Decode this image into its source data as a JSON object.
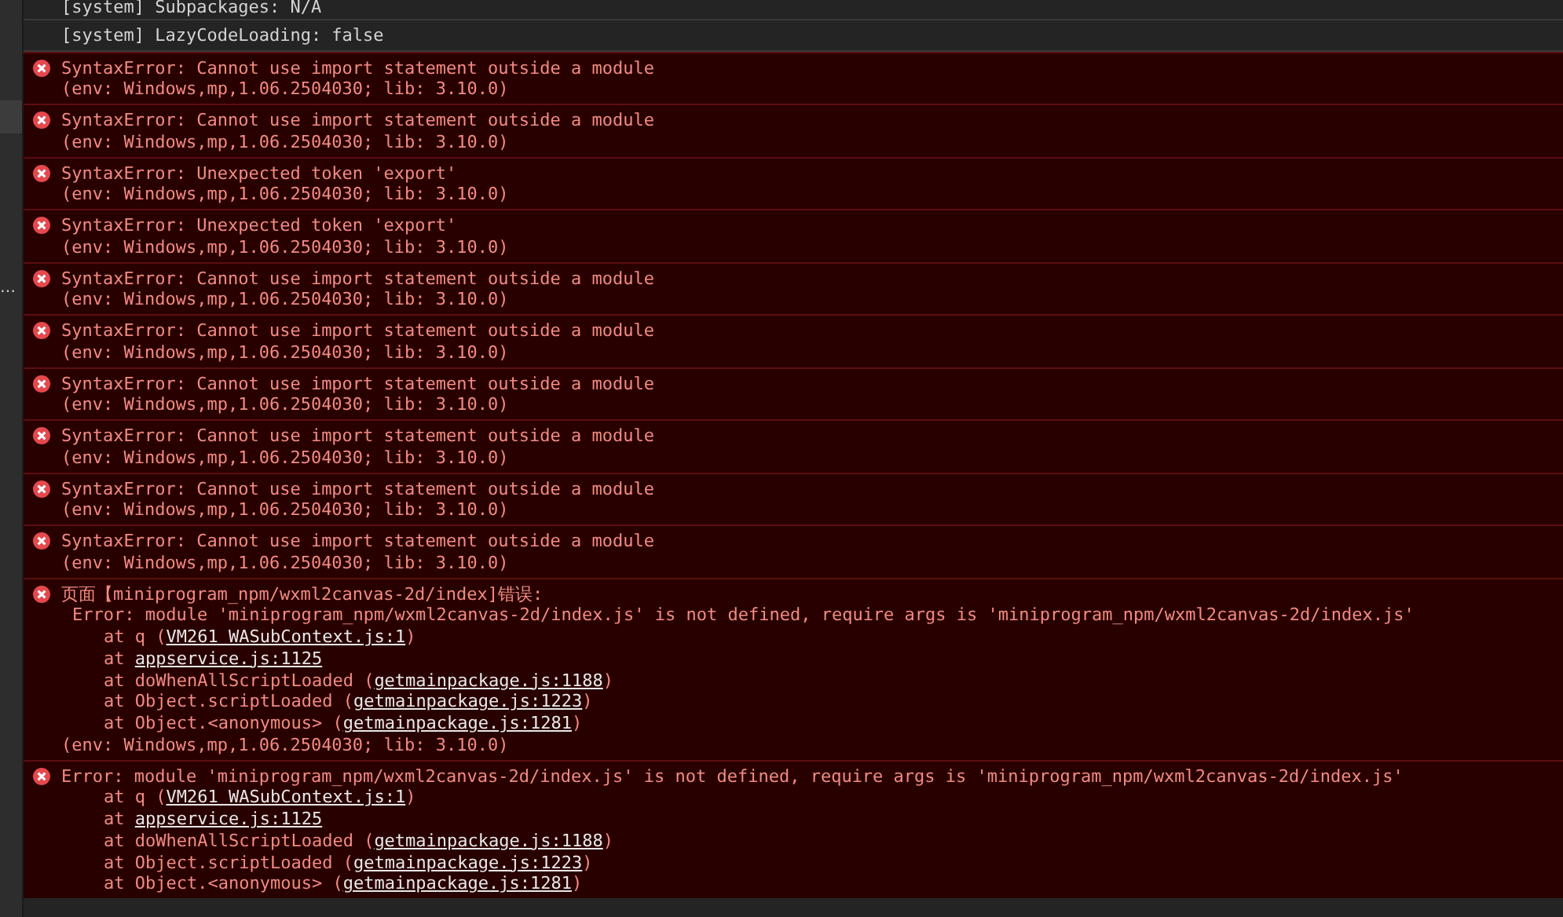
{
  "sidebar": {
    "cut_label": "…"
  },
  "messages": [
    {
      "kind": "system",
      "lines": [
        {
          "kind": "text",
          "text": "[system] Subpackages: N/A"
        }
      ]
    },
    {
      "kind": "system",
      "lines": [
        {
          "kind": "text",
          "text": "[system] LazyCodeLoading: false"
        }
      ]
    },
    {
      "kind": "error",
      "lines": [
        {
          "kind": "text",
          "text": "SyntaxError: Cannot use import statement outside a module"
        },
        {
          "kind": "text",
          "text": "(env: Windows,mp,1.06.2504030; lib: 3.10.0)"
        }
      ]
    },
    {
      "kind": "error",
      "lines": [
        {
          "kind": "text",
          "text": "SyntaxError: Cannot use import statement outside a module"
        },
        {
          "kind": "text",
          "text": "(env: Windows,mp,1.06.2504030; lib: 3.10.0)"
        }
      ]
    },
    {
      "kind": "error",
      "lines": [
        {
          "kind": "text",
          "text": "SyntaxError: Unexpected token 'export'"
        },
        {
          "kind": "text",
          "text": "(env: Windows,mp,1.06.2504030; lib: 3.10.0)"
        }
      ]
    },
    {
      "kind": "error",
      "lines": [
        {
          "kind": "text",
          "text": "SyntaxError: Unexpected token 'export'"
        },
        {
          "kind": "text",
          "text": "(env: Windows,mp,1.06.2504030; lib: 3.10.0)"
        }
      ]
    },
    {
      "kind": "error",
      "lines": [
        {
          "kind": "text",
          "text": "SyntaxError: Cannot use import statement outside a module"
        },
        {
          "kind": "text",
          "text": "(env: Windows,mp,1.06.2504030; lib: 3.10.0)"
        }
      ]
    },
    {
      "kind": "error",
      "lines": [
        {
          "kind": "text",
          "text": "SyntaxError: Cannot use import statement outside a module"
        },
        {
          "kind": "text",
          "text": "(env: Windows,mp,1.06.2504030; lib: 3.10.0)"
        }
      ]
    },
    {
      "kind": "error",
      "lines": [
        {
          "kind": "text",
          "text": "SyntaxError: Cannot use import statement outside a module"
        },
        {
          "kind": "text",
          "text": "(env: Windows,mp,1.06.2504030; lib: 3.10.0)"
        }
      ]
    },
    {
      "kind": "error",
      "lines": [
        {
          "kind": "text",
          "text": "SyntaxError: Cannot use import statement outside a module"
        },
        {
          "kind": "text",
          "text": "(env: Windows,mp,1.06.2504030; lib: 3.10.0)"
        }
      ]
    },
    {
      "kind": "error",
      "lines": [
        {
          "kind": "text",
          "text": "SyntaxError: Cannot use import statement outside a module"
        },
        {
          "kind": "text",
          "text": "(env: Windows,mp,1.06.2504030; lib: 3.10.0)"
        }
      ]
    },
    {
      "kind": "error",
      "lines": [
        {
          "kind": "text",
          "text": "SyntaxError: Cannot use import statement outside a module"
        },
        {
          "kind": "text",
          "text": "(env: Windows,mp,1.06.2504030; lib: 3.10.0)"
        }
      ]
    },
    {
      "kind": "error",
      "lines": [
        {
          "kind": "text",
          "text": "页面【miniprogram_npm/wxml2canvas-2d/index]错误:"
        },
        {
          "kind": "detail",
          "text": "Error: module 'miniprogram_npm/wxml2canvas-2d/index.js' is not defined, require args is 'miniprogram_npm/wxml2canvas-2d/index.js'"
        },
        {
          "kind": "stack",
          "before": "at q (",
          "link": "VM261 WASubContext.js:1",
          "after": ")"
        },
        {
          "kind": "stack",
          "before": "at ",
          "link": "appservice.js:1125"
        },
        {
          "kind": "stack",
          "before": "at doWhenAllScriptLoaded (",
          "link": "getmainpackage.js:1188",
          "after": ")"
        },
        {
          "kind": "stack",
          "before": "at Object.scriptLoaded (",
          "link": "getmainpackage.js:1223",
          "after": ")"
        },
        {
          "kind": "stack",
          "before": "at Object.<anonymous> (",
          "link": "getmainpackage.js:1281",
          "after": ")"
        },
        {
          "kind": "text",
          "text": "(env: Windows,mp,1.06.2504030; lib: 3.10.0)"
        }
      ]
    },
    {
      "kind": "error",
      "lines": [
        {
          "kind": "text",
          "text": "Error: module 'miniprogram_npm/wxml2canvas-2d/index.js' is not defined, require args is 'miniprogram_npm/wxml2canvas-2d/index.js'"
        },
        {
          "kind": "stack",
          "before": "at q (",
          "link": "VM261 WASubContext.js:1",
          "after": ")"
        },
        {
          "kind": "stack",
          "before": "at ",
          "link": "appservice.js:1125"
        },
        {
          "kind": "stack",
          "before": "at doWhenAllScriptLoaded (",
          "link": "getmainpackage.js:1188",
          "after": ")"
        },
        {
          "kind": "stack",
          "before": "at Object.scriptLoaded (",
          "link": "getmainpackage.js:1223",
          "after": ")"
        },
        {
          "kind": "stack",
          "before": "at Object.<anonymous> (",
          "link": "getmainpackage.js:1281",
          "after": ")"
        }
      ]
    }
  ]
}
